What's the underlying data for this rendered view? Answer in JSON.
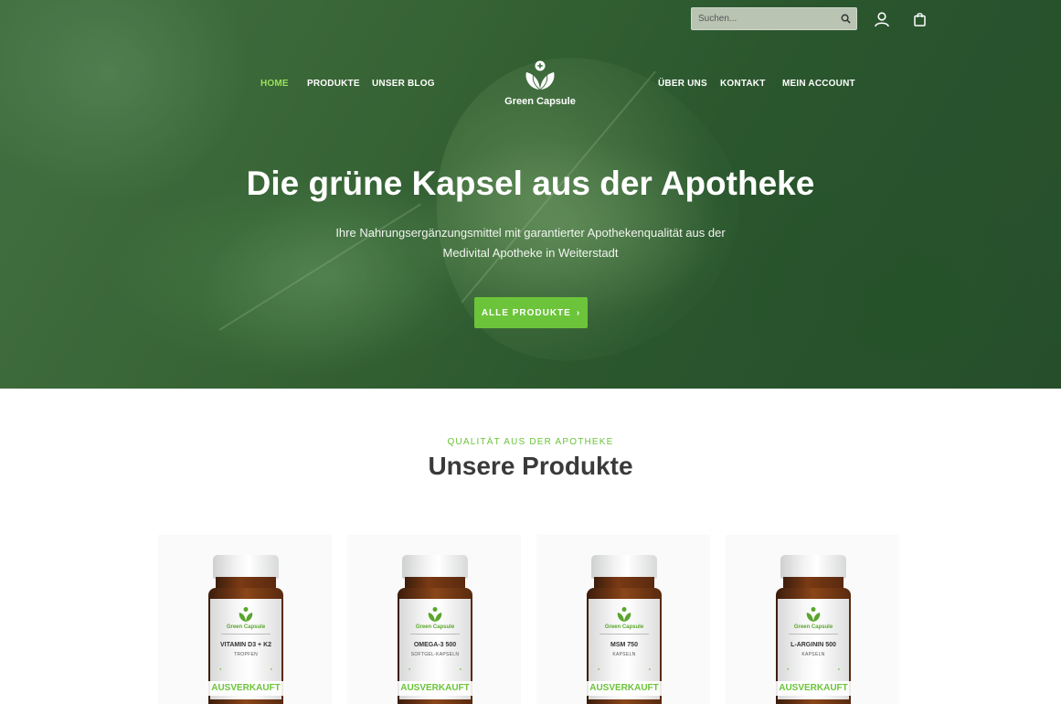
{
  "header": {
    "search": {
      "placeholder": "Suchen..."
    },
    "nav_left": [
      "HOME",
      "PRODUKTE",
      "UNSER BLOG"
    ],
    "nav_right": [
      "ÜBER UNS",
      "KONTAKT",
      "MEIN ACCOUNT"
    ],
    "logo_text": "Green Capsule",
    "active_nav": "HOME"
  },
  "hero": {
    "title": "Die grüne Kapsel aus der Apotheke",
    "subtitle_line1": "Ihre Nahrungsergänzungsmittel mit garantierter Apothekenqualität aus der",
    "subtitle_line2": "Medivital Apotheke in Weiterstadt",
    "cta_label": "ALLE PRODUKTE",
    "cta_arrow": "›"
  },
  "products_section": {
    "eyebrow": "QUALITÄT AUS DER APOTHEKE",
    "title": "Unsere Produkte",
    "products": [
      {
        "label_brand": "Green Capsule",
        "label_name": "VITAMIN D3 + K2",
        "label_type": "TROPFEN",
        "status": "AUSVERKAUFT"
      },
      {
        "label_brand": "Green Capsule",
        "label_name": "OMEGA-3 500",
        "label_type": "SOFTGEL-KAPSELN",
        "status": "AUSVERKAUFT"
      },
      {
        "label_brand": "Green Capsule",
        "label_name": "MSM 750",
        "label_type": "KAPSELN",
        "status": "AUSVERKAUFT"
      },
      {
        "label_brand": "Green Capsule",
        "label_name": "L-ARGININ 500",
        "label_type": "KAPSELN",
        "status": "AUSVERKAUFT"
      }
    ]
  },
  "colors": {
    "accent": "#6cc43a",
    "nav_active": "#9be05a",
    "hero_green": "#3e6f3c"
  },
  "icons": {
    "search": "search-icon",
    "user": "user-icon",
    "cart": "shopping-bag-icon",
    "logo": "leaf-capsule-icon"
  }
}
